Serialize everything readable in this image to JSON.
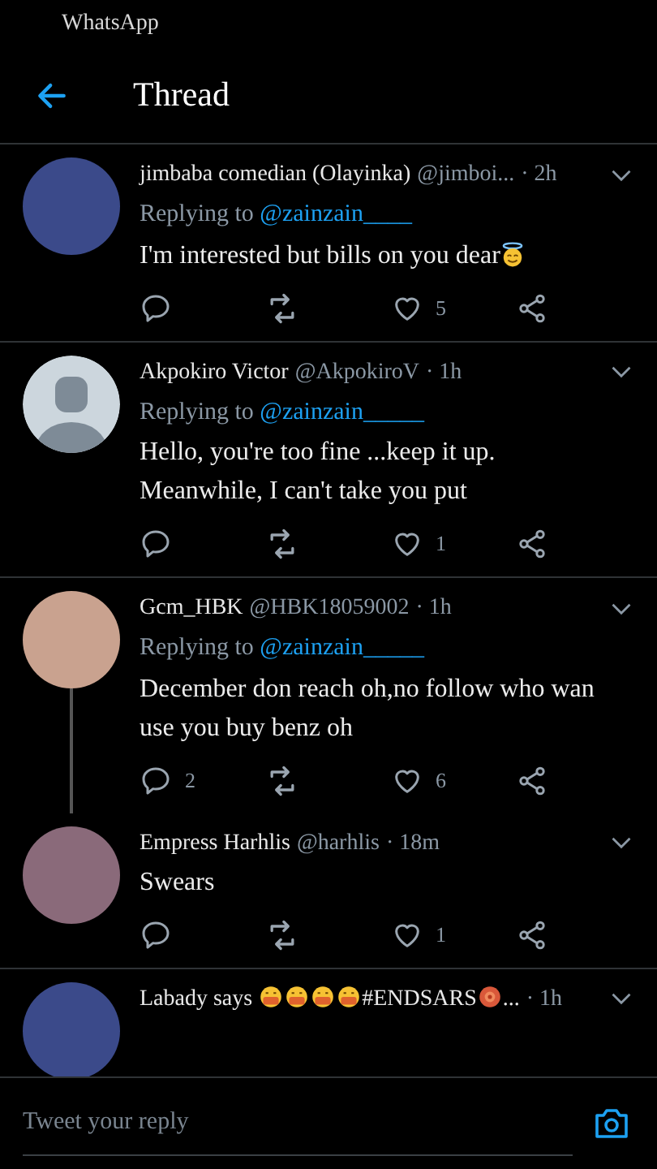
{
  "status_bar": {
    "app": "WhatsApp"
  },
  "header": {
    "title": "Thread"
  },
  "tweets": [
    {
      "avatar": {
        "kind": "photo"
      },
      "name": [
        {
          "kind": "text",
          "text": "jimbaba comedian (Olayinka)"
        }
      ],
      "handle": "@jimboi...",
      "time": "· 2h",
      "replying_label": "Replying to",
      "replying_to": "@zainzain____",
      "body": [
        {
          "kind": "text",
          "text": "I'm interested but bills on you dear"
        },
        {
          "kind": "halo_face"
        }
      ],
      "likes": "5",
      "thread_line": false,
      "divider": true
    },
    {
      "avatar": {
        "kind": "default"
      },
      "name": [
        {
          "kind": "text",
          "text": "Akpokiro Victor"
        }
      ],
      "handle": "@AkpokiroV",
      "time": "· 1h",
      "replying_label": "Replying to",
      "replying_to": "@zainzain_____",
      "body": [
        {
          "kind": "text",
          "text": "Hello, you're too fine ...keep it up. Meanwhile, I can't take you put"
        }
      ],
      "likes": "1",
      "thread_line": false,
      "divider": true
    },
    {
      "avatar": {
        "kind": "photo"
      },
      "name": [
        {
          "kind": "text",
          "text": "Gcm_HBK"
        }
      ],
      "handle": "@HBK18059002",
      "time": "· 1h",
      "replying_label": "Replying to",
      "replying_to": "@zainzain_____",
      "body": [
        {
          "kind": "text",
          "text": "December don reach oh,no follow who wan use you buy benz oh"
        }
      ],
      "replies": "2",
      "likes": "6",
      "thread_line": true,
      "divider": false
    },
    {
      "avatar": {
        "kind": "photo"
      },
      "name": [
        {
          "kind": "text",
          "text": "Empress Harhlis"
        }
      ],
      "handle": "@harhlis",
      "time": "· 18m",
      "body": [
        {
          "kind": "text",
          "text": "Swears"
        }
      ],
      "likes": "1",
      "thread_line": false,
      "divider": true
    },
    {
      "avatar": {
        "kind": "photo"
      },
      "name": [
        {
          "kind": "text",
          "text": "Labady says "
        },
        {
          "kind": "mask_face"
        },
        {
          "kind": "mask_face"
        },
        {
          "kind": "mask_face"
        },
        {
          "kind": "mask_face"
        },
        {
          "kind": "text",
          "text": "#ENDSARS"
        },
        {
          "kind": "flower"
        },
        {
          "kind": "text",
          "text": "..."
        }
      ],
      "time": "· 1h",
      "thread_line": false,
      "divider": false
    }
  ],
  "reply_bar": {
    "placeholder": "Tweet your reply"
  }
}
